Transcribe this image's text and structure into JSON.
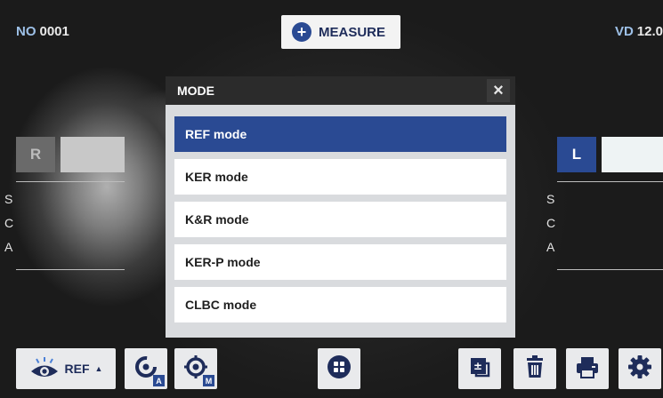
{
  "header": {
    "no_label": "NO",
    "no_value": "0001",
    "measure_label": "MEASURE",
    "vd_label": "VD",
    "vd_value": "12.0"
  },
  "left_eye_panel": {
    "eye_label": "R",
    "params": [
      "S",
      "C",
      "A"
    ]
  },
  "right_eye_panel": {
    "eye_label": "L",
    "params": [
      "S",
      "C",
      "A"
    ]
  },
  "modal": {
    "title": "MODE",
    "close_symbol": "×",
    "items": [
      {
        "label": "REF mode",
        "selected": true
      },
      {
        "label": "KER mode",
        "selected": false
      },
      {
        "label": "K&R mode",
        "selected": false
      },
      {
        "label": "KER-P mode",
        "selected": false
      },
      {
        "label": "CLBC mode",
        "selected": false
      }
    ]
  },
  "toolbar": {
    "ref_label": "REF",
    "ref_arrow": "▲",
    "auto_badge": "A",
    "manual_badge": "M",
    "icons": [
      "eye-icon",
      "auto-measure-icon",
      "manual-measure-icon",
      "center-icon",
      "plus-minus-icon",
      "trash-icon",
      "print-icon",
      "gear-icon"
    ]
  },
  "colors": {
    "accent": "#2a4a93",
    "label_blue": "#9ec1e8"
  }
}
